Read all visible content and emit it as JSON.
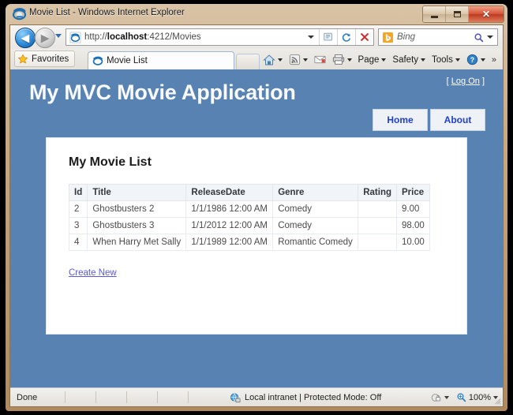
{
  "window": {
    "title": "Movie List - Windows Internet Explorer",
    "minimize_label": "–",
    "maximize_label": "",
    "close_label": "✕"
  },
  "navigation": {
    "back_label": "◀",
    "forward_label": "▶",
    "address_prefix": "http://",
    "address_host": "localhost",
    "address_rest": ":4212/Movies",
    "address_full": "http://localhost:4212/Movies",
    "search_placeholder": "Bing"
  },
  "tabs": {
    "favorites_label": "Favorites",
    "active_tab_label": "Movie List"
  },
  "command_bar": {
    "items": [
      {
        "label": "Page"
      },
      {
        "label": "Safety"
      },
      {
        "label": "Tools"
      }
    ]
  },
  "site": {
    "title": "My MVC Movie Application",
    "logon_open_bracket": "[",
    "logon_label": "Log On",
    "logon_close_bracket": "]",
    "nav": [
      {
        "label": "Home"
      },
      {
        "label": "About"
      }
    ]
  },
  "main": {
    "heading": "My Movie List",
    "create_new_label": "Create New",
    "table": {
      "columns": [
        "Id",
        "Title",
        "ReleaseDate",
        "Genre",
        "Rating",
        "Price"
      ],
      "rows": [
        {
          "id": "2",
          "title": "Ghostbusters 2",
          "release_date": "1/1/1986 12:00 AM",
          "genre": "Comedy",
          "rating": "",
          "price": "9.00"
        },
        {
          "id": "3",
          "title": "Ghostbusters 3",
          "release_date": "1/1/2012 12:00 AM",
          "genre": "Comedy",
          "rating": "",
          "price": "98.00"
        },
        {
          "id": "4",
          "title": "When Harry Met Sally",
          "release_date": "1/1/1989 12:00 AM",
          "genre": "Romantic Comedy",
          "rating": "",
          "price": "10.00"
        }
      ]
    }
  },
  "status": {
    "text": "Done",
    "zone": "Local intranet | Protected Mode: Off",
    "zoom": "100%"
  },
  "colors": {
    "page_background": "#5882b2",
    "header_blue": "#5882b2",
    "nav_button_text": "#1e3fd0",
    "link": "#5b5bd6",
    "table_header_bg": "#f1f4f8",
    "close_button": "#c4442a"
  }
}
